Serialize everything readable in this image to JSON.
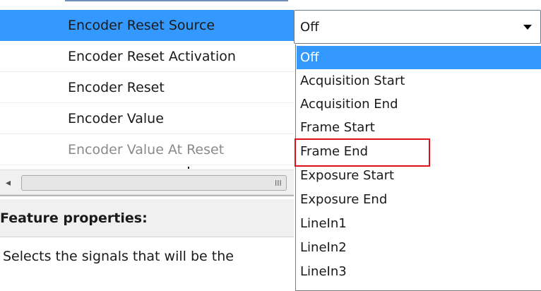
{
  "property_grid": {
    "rows": [
      {
        "label": "Encoder Reset Source",
        "state": "selected"
      },
      {
        "label": "Encoder Reset Activation",
        "state": "normal"
      },
      {
        "label": "Encoder Reset",
        "state": "normal"
      },
      {
        "label": "Encoder Value",
        "state": "normal"
      },
      {
        "label": "Encoder Value At Reset",
        "state": "disabled"
      }
    ]
  },
  "scrollbar": {
    "left_arrow": "◂",
    "grip": "III"
  },
  "feature_properties": {
    "title": "Feature properties:",
    "description": "Selects the signals that will be the"
  },
  "combo": {
    "selected_value": "Off"
  },
  "dropdown": {
    "options": [
      {
        "label": "Off",
        "selected": true
      },
      {
        "label": "Acquisition Start",
        "selected": false
      },
      {
        "label": "Acquisition End",
        "selected": false
      },
      {
        "label": "Frame Start",
        "selected": false
      },
      {
        "label": "Frame End",
        "selected": false
      },
      {
        "label": "Exposure Start",
        "selected": false
      },
      {
        "label": "Exposure End",
        "selected": false
      },
      {
        "label": "LineIn1",
        "selected": false
      },
      {
        "label": "LineIn2",
        "selected": false
      },
      {
        "label": "LineIn3",
        "selected": false
      }
    ],
    "highlighted_option": "Frame End"
  },
  "colors": {
    "selection": "#3399ff",
    "highlight_box": "#e0101a"
  }
}
